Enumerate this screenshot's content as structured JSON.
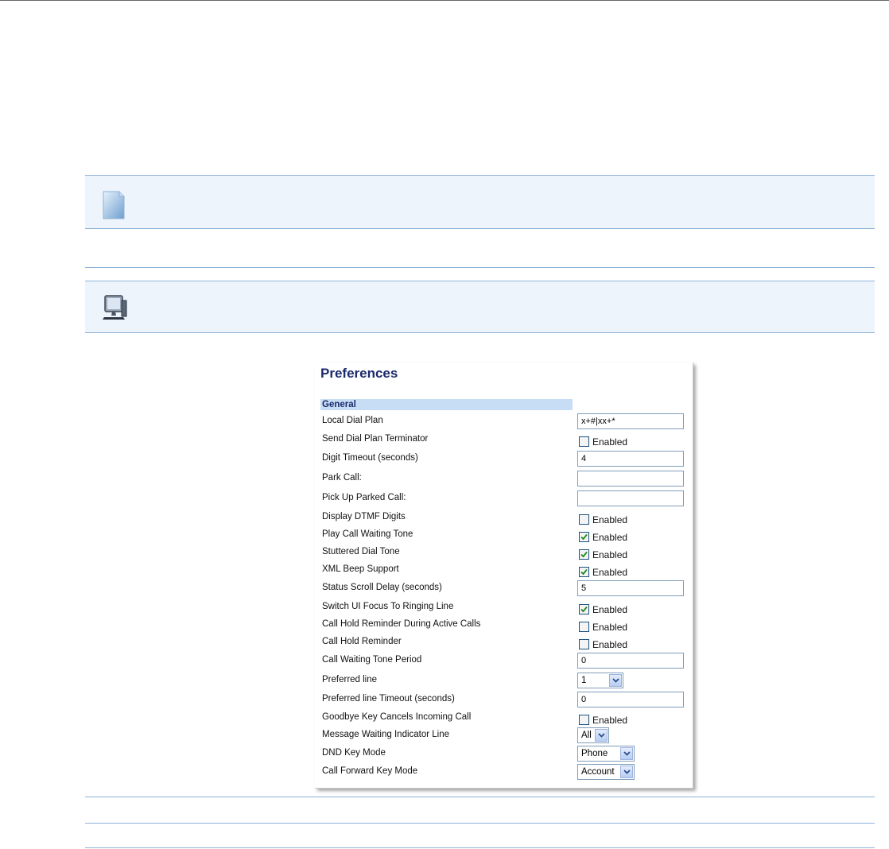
{
  "panel": {
    "title": "Preferences",
    "section": "General",
    "enabled_label": "Enabled",
    "rows": [
      {
        "label": "Local Dial Plan",
        "type": "text",
        "value": "x+#|xx+*"
      },
      {
        "label": "Send Dial Plan Terminator",
        "type": "checkbox",
        "checked": false
      },
      {
        "label": "Digit Timeout (seconds)",
        "type": "text",
        "value": "4"
      },
      {
        "label": "Park Call:",
        "type": "text",
        "value": ""
      },
      {
        "label": "Pick Up Parked Call:",
        "type": "text",
        "value": ""
      },
      {
        "label": "Display DTMF Digits",
        "type": "checkbox",
        "checked": false
      },
      {
        "label": "Play Call Waiting Tone",
        "type": "checkbox",
        "checked": true
      },
      {
        "label": "Stuttered Dial Tone",
        "type": "checkbox",
        "checked": true
      },
      {
        "label": "XML Beep Support",
        "type": "checkbox",
        "checked": true
      },
      {
        "label": "Status Scroll Delay (seconds)",
        "type": "text",
        "value": "5"
      },
      {
        "label": "Switch UI Focus To Ringing Line",
        "type": "checkbox",
        "checked": true
      },
      {
        "label": "Call Hold Reminder During Active Calls",
        "type": "checkbox",
        "checked": false
      },
      {
        "label": "Call Hold Reminder",
        "type": "checkbox",
        "checked": false
      },
      {
        "label": "Call Waiting Tone Period",
        "type": "text",
        "value": "0"
      },
      {
        "label": "Preferred line",
        "type": "select",
        "value": "1"
      },
      {
        "label": "Preferred line Timeout (seconds)",
        "type": "text",
        "value": "0"
      },
      {
        "label": "Goodbye Key Cancels Incoming Call",
        "type": "checkbox",
        "checked": false
      },
      {
        "label": "Message Waiting Indicator Line",
        "type": "select",
        "value": "All"
      },
      {
        "label": "DND Key Mode",
        "type": "select",
        "value": "Phone"
      },
      {
        "label": "Call Forward Key Mode",
        "type": "select",
        "value": "Account"
      }
    ]
  },
  "icons": {
    "note": "note-page-icon",
    "webui": "computer-monitor-icon"
  },
  "colors": {
    "rule": "#8fb3d9",
    "band": "#eef4fb",
    "section_head": "#c7dcf5",
    "title": "#1a2a6c",
    "checkmark": "#1f8a1f"
  }
}
